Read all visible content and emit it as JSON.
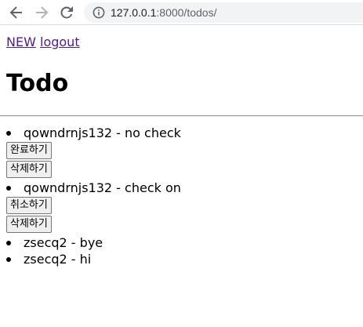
{
  "browser": {
    "url_host": "127.0.0.1",
    "url_rest": ":8000/todos/"
  },
  "nav": {
    "new_label": "NEW",
    "logout_label": "logout"
  },
  "page": {
    "title": "Todo"
  },
  "todos": [
    {
      "text": "qowndrnjs132 - no check",
      "toggle_label": "완료하기",
      "delete_label": "삭제하기"
    },
    {
      "text": "qowndrnjs132 - check on",
      "toggle_label": "취소하기",
      "delete_label": "삭제하기"
    },
    {
      "text": "zsecq2 - bye"
    },
    {
      "text": "zsecq2 - hi"
    }
  ]
}
